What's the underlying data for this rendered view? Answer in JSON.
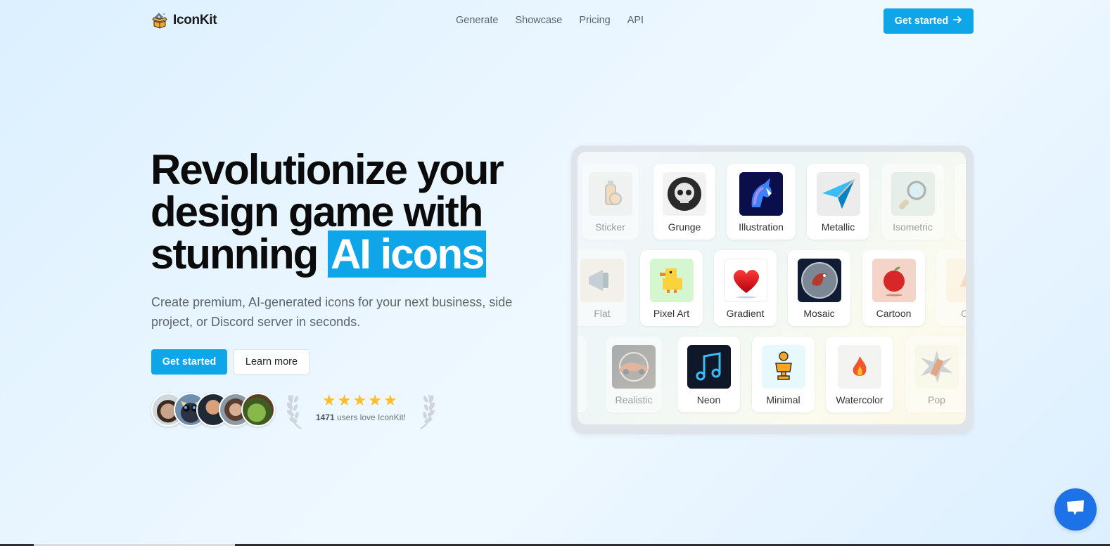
{
  "nav": {
    "brand": "IconKit",
    "brand_icon": "gear-box-icon",
    "links": [
      "Generate",
      "Showcase",
      "Pricing",
      "API"
    ],
    "cta_label": "Get started",
    "cta_icon": "arrow-right-icon"
  },
  "hero": {
    "title_line1": "Revolutionize your",
    "title_line2": "design game with",
    "title_line3_plain": "stunning",
    "title_line3_highlight": "AI icons",
    "subtitle": "Create premium, AI-generated icons for your next business, side project, or Discord server in seconds.",
    "primary_button": "Get started",
    "secondary_button": "Learn more"
  },
  "social_proof": {
    "avatars": [
      "user-avatar-1",
      "cat-with-sunglasses-avatar",
      "user-avatar-3",
      "user-avatar-4",
      "frog-avatar"
    ],
    "stars": 5,
    "max_stars": 5,
    "user_count": "1471",
    "rating_text": "users love IconKit!"
  },
  "showcase": {
    "rows": [
      [
        {
          "label": "Sticker",
          "icon": "spray-bottle-icon",
          "faded": true
        },
        {
          "label": "Grunge",
          "icon": "skull-icon",
          "faded": false
        },
        {
          "label": "Illustration",
          "icon": "unicorn-icon",
          "faded": false
        },
        {
          "label": "Metallic",
          "icon": "paper-plane-icon",
          "faded": false
        },
        {
          "label": "Isometric",
          "icon": "magnifier-icon",
          "faded": true
        }
      ],
      [
        {
          "label": "Flat",
          "icon": "megaphone-icon",
          "faded": true
        },
        {
          "label": "Pixel Art",
          "icon": "duck-icon",
          "faded": false
        },
        {
          "label": "Gradient",
          "icon": "heart-icon",
          "faded": false
        },
        {
          "label": "Mosaic",
          "icon": "bird-icon",
          "faded": false
        },
        {
          "label": "Cartoon",
          "icon": "apple-icon",
          "faded": false
        },
        {
          "label": "Ori",
          "icon": "origami-icon",
          "faded": true
        }
      ],
      [
        {
          "label": "Realistic",
          "icon": "car-icon",
          "faded": true
        },
        {
          "label": "Neon",
          "icon": "music-note-icon",
          "faded": false
        },
        {
          "label": "Minimal",
          "icon": "trophy-icon",
          "faded": false
        },
        {
          "label": "Watercolor",
          "icon": "flame-icon",
          "faded": false
        },
        {
          "label": "Pop",
          "icon": "lipstick-icon",
          "faded": true
        }
      ]
    ]
  },
  "chat": {
    "icon": "chat-bubble-icon"
  },
  "colors": {
    "accent": "#0ea5e9",
    "chat": "#1d72e8",
    "star": "#fbbf24",
    "heading": "#0b0b0b",
    "muted": "#5d6470"
  }
}
